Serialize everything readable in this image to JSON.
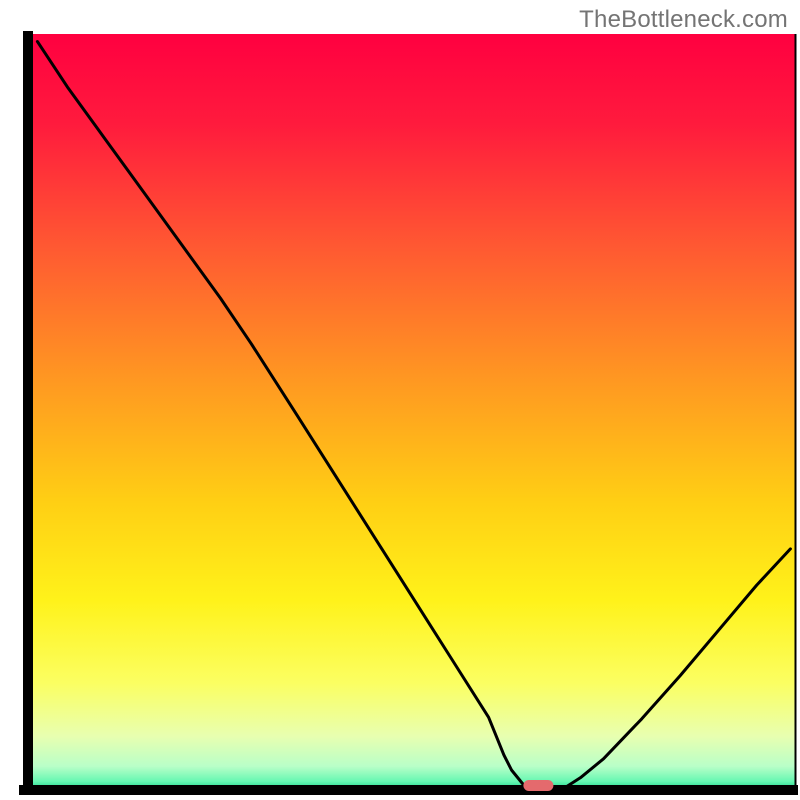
{
  "watermark": "TheBottleneck.com",
  "chart_data": {
    "type": "line",
    "title": "",
    "xlabel": "",
    "ylabel": "",
    "xlim": [
      0,
      100
    ],
    "ylim": [
      0,
      100
    ],
    "x": [
      1.1,
      5,
      10,
      15,
      20,
      25,
      29,
      35,
      40,
      45,
      50,
      55,
      60,
      62,
      63,
      65,
      68,
      70,
      72,
      75,
      80,
      85,
      90,
      95,
      99.4
    ],
    "y": [
      99.0,
      93.0,
      86.0,
      79.0,
      72.0,
      65.0,
      59.0,
      49.5,
      41.5,
      33.5,
      25.5,
      17.5,
      9.5,
      4.5,
      2.5,
      0.0,
      0.0,
      0.2,
      1.5,
      4.0,
      9.3,
      15.0,
      21.0,
      27.0,
      31.8
    ],
    "marker": {
      "x": 66.5,
      "y": -0.2
    },
    "background_gradient": {
      "stops": [
        {
          "offset": 0.0,
          "color": "#ff0040"
        },
        {
          "offset": 0.12,
          "color": "#ff1b3d"
        },
        {
          "offset": 0.28,
          "color": "#ff5832"
        },
        {
          "offset": 0.45,
          "color": "#ff9522"
        },
        {
          "offset": 0.62,
          "color": "#ffcf14"
        },
        {
          "offset": 0.75,
          "color": "#fff21a"
        },
        {
          "offset": 0.86,
          "color": "#fbff62"
        },
        {
          "offset": 0.93,
          "color": "#e8ffb0"
        },
        {
          "offset": 0.97,
          "color": "#b9ffc8"
        },
        {
          "offset": 0.99,
          "color": "#66f7b2"
        },
        {
          "offset": 1.0,
          "color": "#1fd58d"
        }
      ]
    },
    "colors": {
      "axis": "#000000",
      "curve": "#000000",
      "marker_fill": "#e46a6d",
      "marker_stroke": "#c04a4d"
    }
  }
}
